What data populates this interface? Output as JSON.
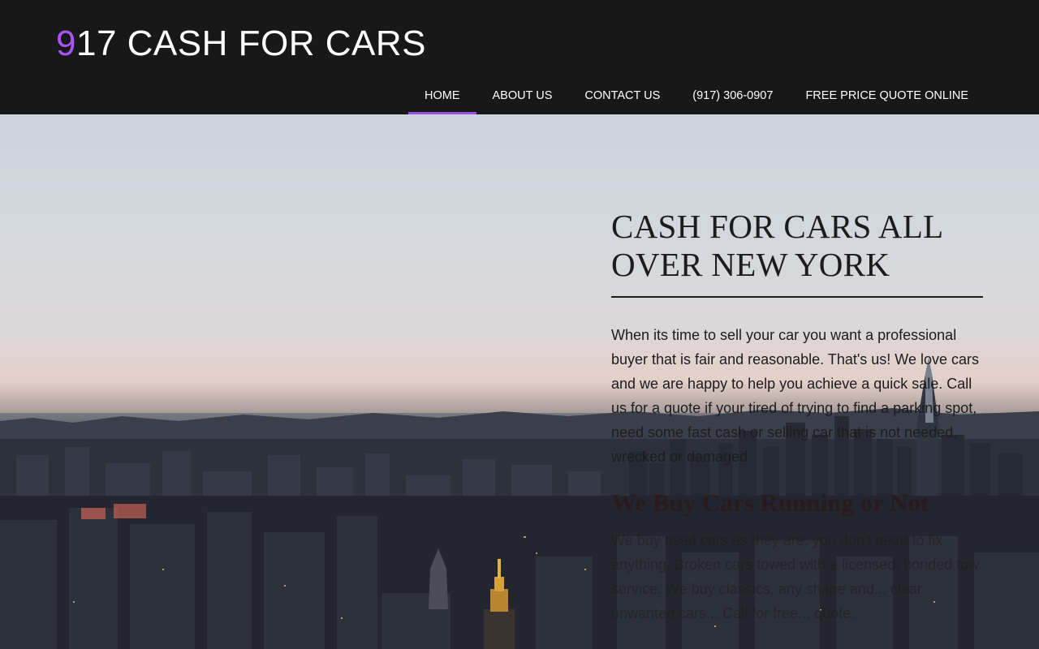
{
  "brand": {
    "logo_accent": "9",
    "logo_rest": "17 CASH FOR CARS",
    "accent_color": "#a855f7"
  },
  "nav": {
    "items": [
      {
        "label": "HOME",
        "active": true
      },
      {
        "label": "ABOUT US",
        "active": false
      },
      {
        "label": "CONTACT US",
        "active": false
      },
      {
        "label": "(917) 306-0907",
        "active": false
      },
      {
        "label": "FREE PRICE QUOTE ONLINE",
        "active": false
      }
    ]
  },
  "hero": {
    "headline": "CASH FOR CARS ALL OVER NEW YORK",
    "intro": "When its time to sell your car you want a professional buyer that is fair and reasonable. That's us! We love cars and we are happy to help you achieve a quick sale.  Call us for a quote if your tired of trying to find a parking spot, need some fast cash or selling car that is not needed, wrecked or damaged.",
    "subheading": "We Buy Cars Running or Not",
    "body": "We buy used cars as they are, you don't need to fix anything.  Broken cars towed with a licensed, bonded tow service. We buy classics, any shape and... clear unwanted cars... Call for free... quote."
  }
}
